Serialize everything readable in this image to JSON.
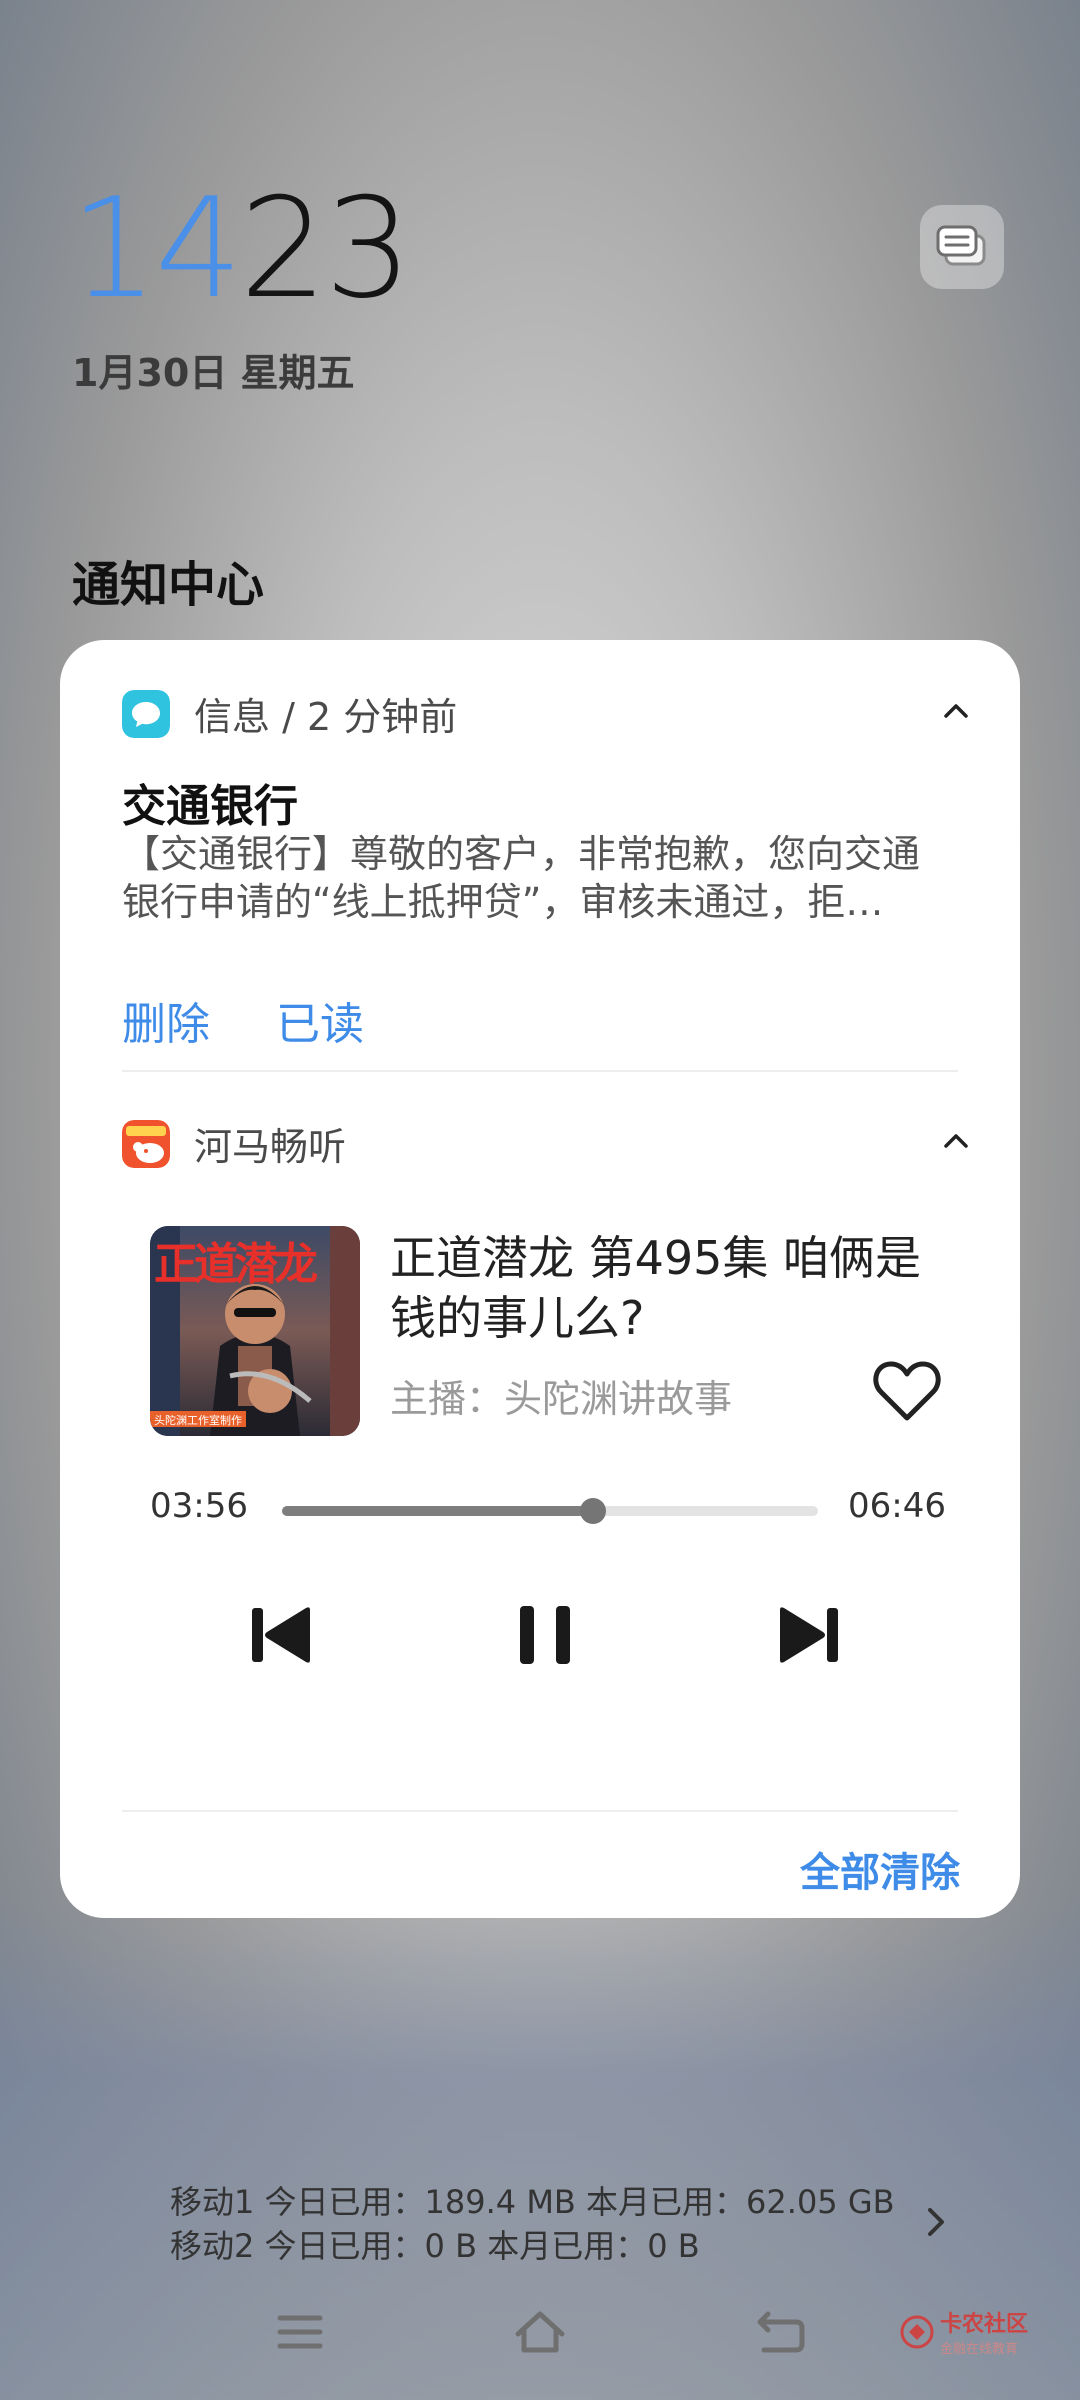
{
  "lockscreen": {
    "time_hour": "14",
    "time_minute": "23",
    "date": "1月30日 星期五"
  },
  "notification_center": {
    "title": "通知中心",
    "clear_all_label": "全部清除"
  },
  "sms_notification": {
    "app_name": "信息",
    "separator": "/",
    "age": "2 分钟前",
    "title": "交通银行",
    "body_line1": "【交通银行】尊敬的客户，非常抱歉，您向交通",
    "body_line2": "银行申请的“线上抵押贷”，审核未通过，拒…",
    "actions": {
      "delete": "删除",
      "mark_read": "已读"
    }
  },
  "media_notification": {
    "app_name": "河马畅听",
    "track_title": "正道潜龙 第495集 咱俩是钱的事儿么?",
    "host": "主播：头陀渊讲故事",
    "elapsed": "03:56",
    "duration": "06:46",
    "progress": 0.58,
    "cover_text": "正道潜龙",
    "cover_caption": "头陀渊工作室制作"
  },
  "data_usage": {
    "line1": "移动1 今日已用：189.4 MB 本月已用：62.05 GB",
    "line2": "移动2 今日已用：0 B 本月已用：0 B"
  },
  "watermark": {
    "name": "卡农社区",
    "sub": "金融在线教育"
  },
  "colors": {
    "accent": "#3f8be8",
    "hour": "#4a8fe8",
    "sms_icon": "#2fc3df",
    "media_icon": "#f0522e"
  }
}
